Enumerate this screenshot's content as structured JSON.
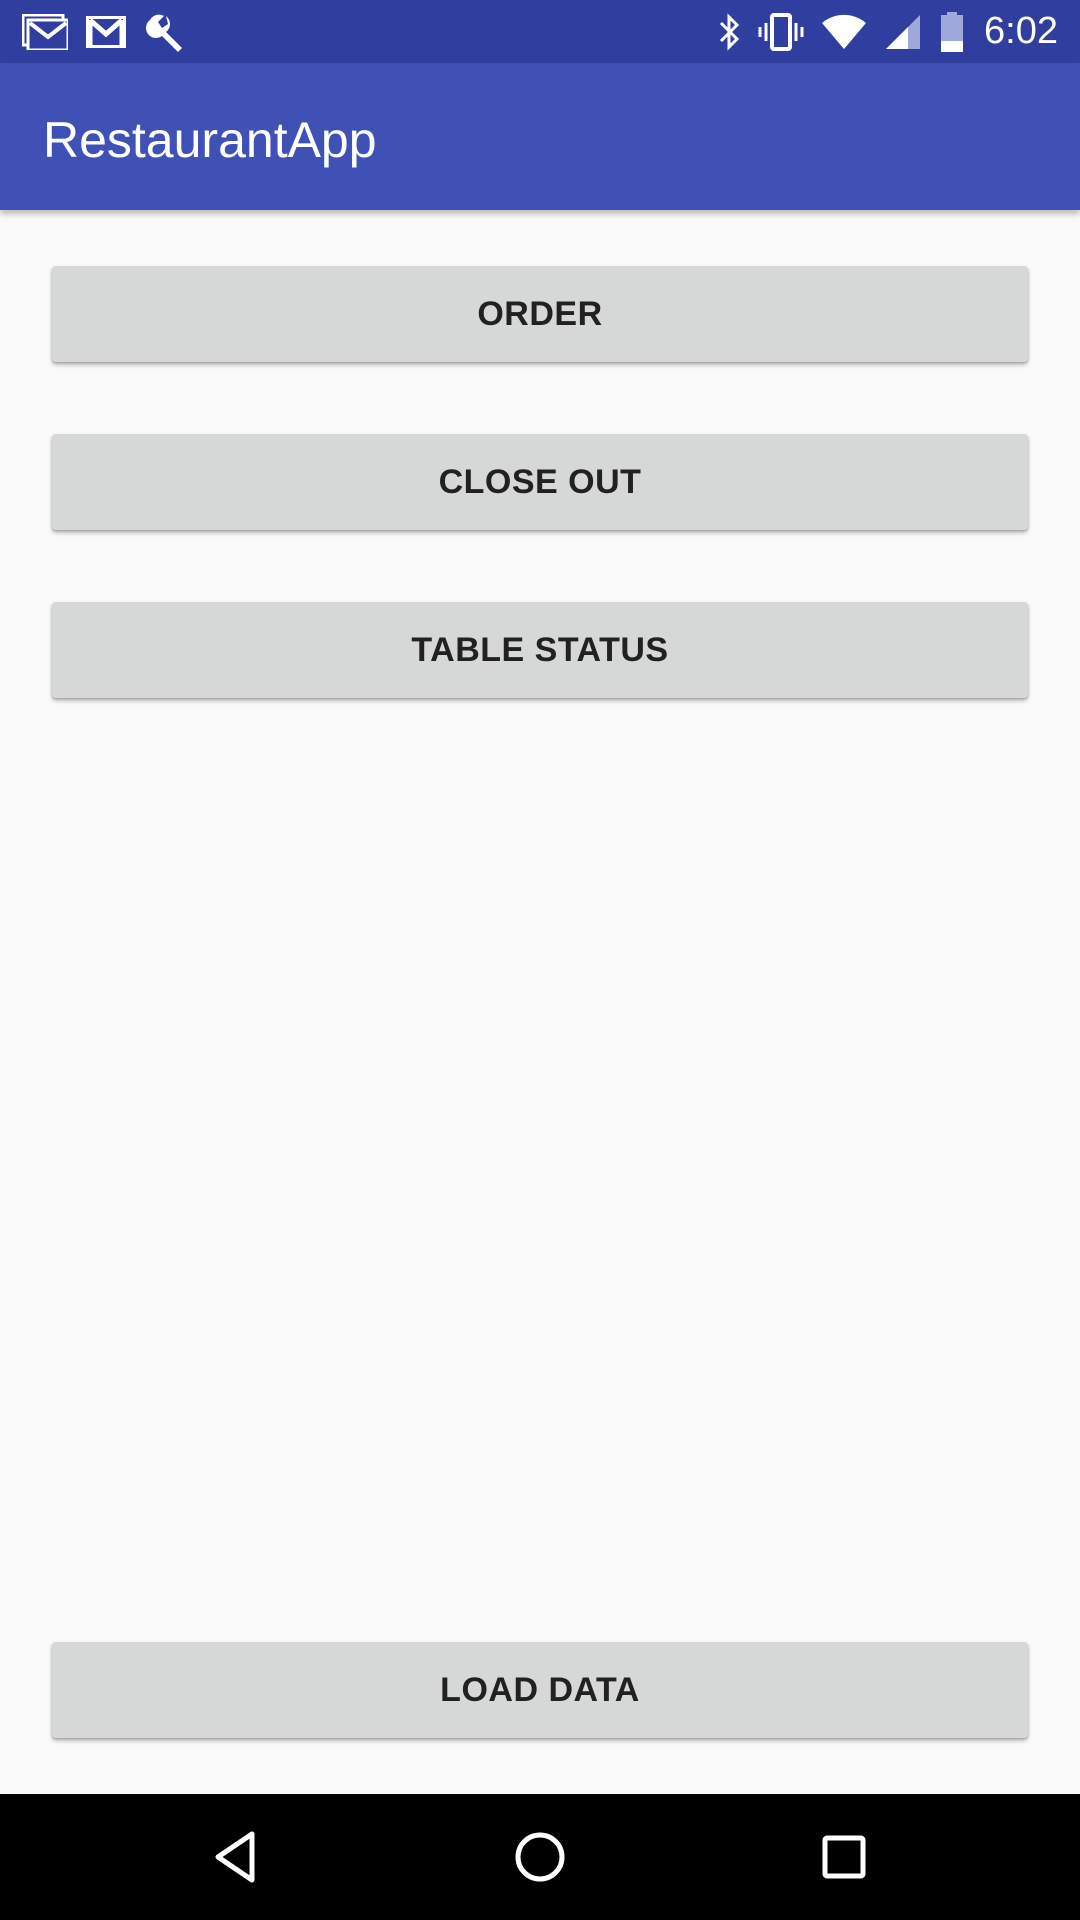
{
  "status_bar": {
    "time": "6:02",
    "left_icons": [
      "gmail-icon",
      "gmail-icon",
      "wrench-icon"
    ],
    "right_icons": [
      "bluetooth-icon",
      "vibrate-icon",
      "wifi-icon",
      "cell-signal-icon",
      "battery-icon"
    ],
    "background_color": "#303f9f"
  },
  "app_bar": {
    "title": "RestaurantApp",
    "background_color": "#3f51b5"
  },
  "main": {
    "buttons": [
      {
        "label": "ORDER"
      },
      {
        "label": "CLOSE OUT"
      },
      {
        "label": "TABLE STATUS"
      }
    ],
    "load_data_label": "LOAD DATA",
    "button_color": "#d6d7d7"
  },
  "nav_bar": {
    "icons": [
      "back-icon",
      "home-icon",
      "recents-icon"
    ]
  }
}
